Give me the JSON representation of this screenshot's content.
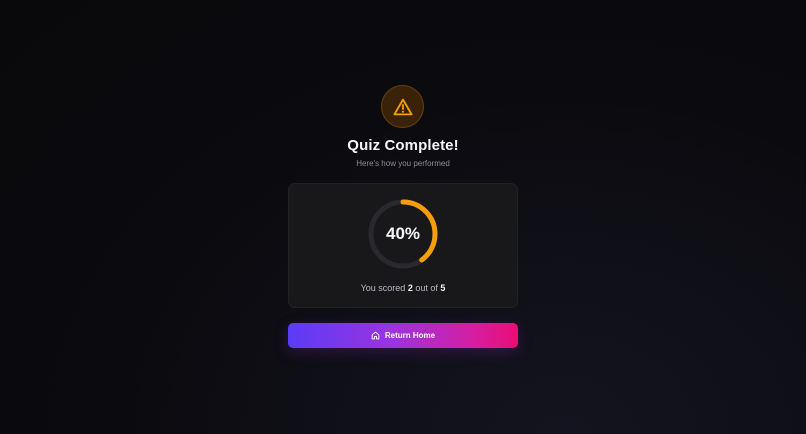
{
  "result": {
    "icon": "warning-triangle-icon",
    "title": "Quiz Complete!",
    "subtitle": "Here's how you performed"
  },
  "score": {
    "percent_label": "40%",
    "percent": 40,
    "prefix": "You scored",
    "correct": "2",
    "middle": "out of",
    "total": "5"
  },
  "actions": {
    "home_label": "Return Home",
    "home_icon": "home-icon"
  },
  "colors": {
    "accent_orange": "#f59e0b",
    "ring_track": "#2a2a2e",
    "button_gradient_start": "#5b3cf6",
    "button_gradient_end": "#ea0d74"
  }
}
